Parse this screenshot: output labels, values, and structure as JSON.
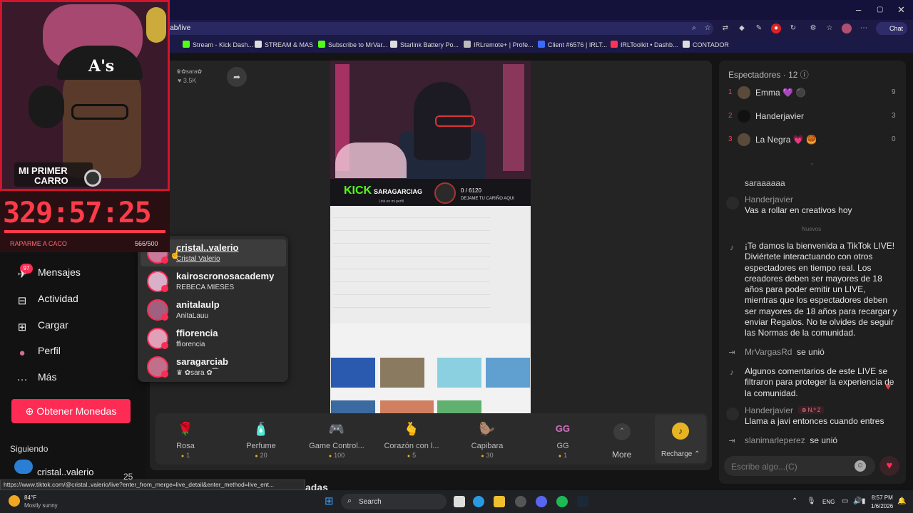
{
  "browser": {
    "url": "iab/live",
    "chat_label": "Chat",
    "bookmarks": [
      {
        "label": "Stream - Kick Dash...",
        "color": "#53fc18"
      },
      {
        "label": "STREAM & MAS",
        "color": "#dddddd"
      },
      {
        "label": "Subscribe to MrVar...",
        "color": "#53fc18"
      },
      {
        "label": "Starlink Battery Po...",
        "color": "#dddddd"
      },
      {
        "label": "IRLremote+ | Profe...",
        "color": "#bbbbbb"
      },
      {
        "label": "Client #6576 | IRLT...",
        "color": "#3a6bff"
      },
      {
        "label": "IRLToolkit • Dashb...",
        "color": "#ff3355"
      },
      {
        "label": "CONTADOR",
        "color": "#dddddd"
      }
    ]
  },
  "overlay": {
    "webcam_text_line1": "MI PRIMER",
    "webcam_text_line2": "CARRO",
    "cap_logo": "A's",
    "timer": "329:57:25",
    "goal_label": "RAPARME A CACO",
    "goal_value": "566/500",
    "goal_progress": 1.0
  },
  "nav": {
    "messages_badge": "97",
    "items": [
      {
        "label": "Mensajes",
        "icon": "paper-plane-icon"
      },
      {
        "label": "Actividad",
        "icon": "message-square-icon"
      },
      {
        "label": "Cargar",
        "icon": "plus-square-icon"
      },
      {
        "label": "Perfil",
        "icon": "avatar-icon"
      },
      {
        "label": "Más",
        "icon": "ellipsis-icon"
      }
    ],
    "coins_button": "Obtener Monedas",
    "following_title": "Siguiendo",
    "following_item": "cristal..valerio",
    "following_count": "25"
  },
  "stream": {
    "host_likes": "3.5K",
    "kick_logo": "KICK",
    "kick_name": "SARAGARCIAG",
    "kick_link": "Link en mi perfil",
    "kick_count": "0 / 6120",
    "kick_cta": "DEJAME TU CARIÑO AQUI"
  },
  "mentions": [
    {
      "name": "cristal..valerio",
      "sub": "Cristal Valerio"
    },
    {
      "name": "kairoscronosacademy",
      "sub": "REBECA MIESES"
    },
    {
      "name": "anitalaulp",
      "sub": "AnitaLauu"
    },
    {
      "name": "ffiorencia",
      "sub": "ffiorencia"
    },
    {
      "name": "saragarciab",
      "sub": "♛ ✿sara ✿⁀"
    }
  ],
  "gifts": [
    {
      "name": "Rosa",
      "price": "1",
      "icon": "rose-icon",
      "emoji": "🌹"
    },
    {
      "name": "Perfume",
      "price": "20",
      "icon": "perfume-icon",
      "emoji": "🧴"
    },
    {
      "name": "Game Control...",
      "price": "100",
      "icon": "gamepad-icon",
      "emoji": "🎮"
    },
    {
      "name": "Corazón con l...",
      "price": "5",
      "icon": "heart-hand-icon",
      "emoji": "🫰"
    },
    {
      "name": "Capibara",
      "price": "30",
      "icon": "capybara-icon",
      "emoji": "🦫"
    },
    {
      "name": "GG",
      "price": "1",
      "icon": "gg-icon",
      "emoji": "GG"
    }
  ],
  "gift_more": "More",
  "recharge": "Recharge",
  "viewers": {
    "title": "Espectadores",
    "count": "12",
    "top": [
      {
        "rank": "1",
        "name": "Emma 💜 ⚫",
        "score": "9"
      },
      {
        "rank": "2",
        "name": "Handerjavier",
        "score": "3"
      },
      {
        "rank": "3",
        "name": "La Negra 💗 🥮",
        "score": "0"
      }
    ]
  },
  "chat": {
    "partial_msg": "saraaaaaa",
    "msg1_name": "Handerjavier",
    "msg1_text": "Vas a rollar en creativos hoy",
    "nuevos": "Nuevos",
    "welcome": "¡Te damos la bienvenida a TikTok LIVE! Diviértete interactuando con otros espectadores en tiempo real. Los creadores deben ser mayores de 18 años para poder emitir un LIVE, mientras que los espectadores deben ser mayores de 18 años para recargar y enviar Regalos. No te olvides de seguir las Normas de la comunidad.",
    "join1_name": "MrVargasRd",
    "join_verb": "se unió",
    "filtered": "Algunos comentarios de este LIVE se filtraron para proteger la experiencia de la comunidad.",
    "msg2_name": "Handerjavier",
    "msg2_badge": "N.º 2",
    "msg2_text": "Llama a javi entonces cuando entres",
    "join2_name": "slanimarleperez",
    "input_placeholder": "Escribe algo...(C)"
  },
  "status_url": "https://www.tiktok.com/@cristal..valerio/live?enter_from_merge=live_detail&enter_method=live_ent...",
  "hidden_header": "adas",
  "taskbar": {
    "weather_temp": "84°F",
    "weather_desc": "Mostly sunny",
    "search_label": "Search",
    "lang": "ENG",
    "time": "8:57 PM",
    "date": "1/6/2026"
  }
}
